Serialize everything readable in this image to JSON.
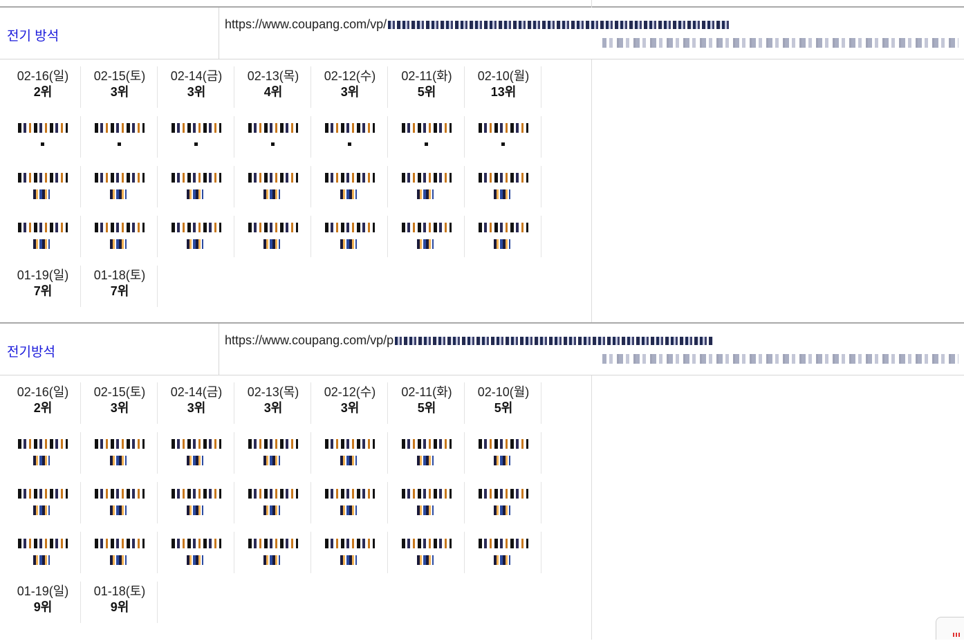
{
  "blocks": [
    {
      "keyword": "전기 방석",
      "url_prefix": "https://www.coupang.com/vp/",
      "rows": [
        [
          {
            "date": "02-16(일)",
            "rank": "2위"
          },
          {
            "date": "02-15(토)",
            "rank": "3위"
          },
          {
            "date": "02-14(금)",
            "rank": "3위"
          },
          {
            "date": "02-13(목)",
            "rank": "4위"
          },
          {
            "date": "02-12(수)",
            "rank": "3위"
          },
          {
            "date": "02-11(화)",
            "rank": "5위"
          },
          {
            "date": "02-10(월)",
            "rank": "13위"
          }
        ],
        [
          {
            "date": "",
            "rank": ""
          },
          {
            "date": "",
            "rank": ""
          },
          {
            "date": "",
            "rank": ""
          },
          {
            "date": "",
            "rank": ""
          },
          {
            "date": "",
            "rank": ""
          },
          {
            "date": "",
            "rank": ""
          },
          {
            "date": "",
            "rank": ""
          }
        ],
        [
          {
            "date": "",
            "rank": ""
          },
          {
            "date": "",
            "rank": ""
          },
          {
            "date": "",
            "rank": ""
          },
          {
            "date": "",
            "rank": ""
          },
          {
            "date": "",
            "rank": ""
          },
          {
            "date": "",
            "rank": ""
          },
          {
            "date": "",
            "rank": ""
          }
        ],
        [
          {
            "date": "",
            "rank": ""
          },
          {
            "date": "",
            "rank": ""
          },
          {
            "date": "",
            "rank": ""
          },
          {
            "date": "",
            "rank": ""
          },
          {
            "date": "",
            "rank": ""
          },
          {
            "date": "",
            "rank": ""
          },
          {
            "date": "",
            "rank": ""
          }
        ],
        [
          {
            "date": "01-19(일)",
            "rank": "7위"
          },
          {
            "date": "01-18(토)",
            "rank": "7위"
          }
        ]
      ]
    },
    {
      "keyword": "전기방석",
      "url_prefix": "https://www.coupang.com/vp/p",
      "rows": [
        [
          {
            "date": "02-16(일)",
            "rank": "2위"
          },
          {
            "date": "02-15(토)",
            "rank": "3위"
          },
          {
            "date": "02-14(금)",
            "rank": "3위"
          },
          {
            "date": "02-13(목)",
            "rank": "3위"
          },
          {
            "date": "02-12(수)",
            "rank": "3위"
          },
          {
            "date": "02-11(화)",
            "rank": "5위"
          },
          {
            "date": "02-10(월)",
            "rank": "5위"
          }
        ],
        [
          {
            "date": "",
            "rank": ""
          },
          {
            "date": "",
            "rank": ""
          },
          {
            "date": "",
            "rank": ""
          },
          {
            "date": "",
            "rank": ""
          },
          {
            "date": "",
            "rank": ""
          },
          {
            "date": "",
            "rank": ""
          },
          {
            "date": "",
            "rank": ""
          }
        ],
        [
          {
            "date": "",
            "rank": ""
          },
          {
            "date": "",
            "rank": ""
          },
          {
            "date": "",
            "rank": ""
          },
          {
            "date": "",
            "rank": ""
          },
          {
            "date": "",
            "rank": ""
          },
          {
            "date": "",
            "rank": ""
          },
          {
            "date": "",
            "rank": ""
          }
        ],
        [
          {
            "date": "",
            "rank": ""
          },
          {
            "date": "",
            "rank": ""
          },
          {
            "date": "",
            "rank": ""
          },
          {
            "date": "",
            "rank": ""
          },
          {
            "date": "",
            "rank": ""
          },
          {
            "date": "",
            "rank": ""
          },
          {
            "date": "",
            "rank": ""
          }
        ],
        [
          {
            "date": "01-19(일)",
            "rank": "9위"
          },
          {
            "date": "01-18(토)",
            "rank": "9위"
          }
        ]
      ]
    }
  ]
}
